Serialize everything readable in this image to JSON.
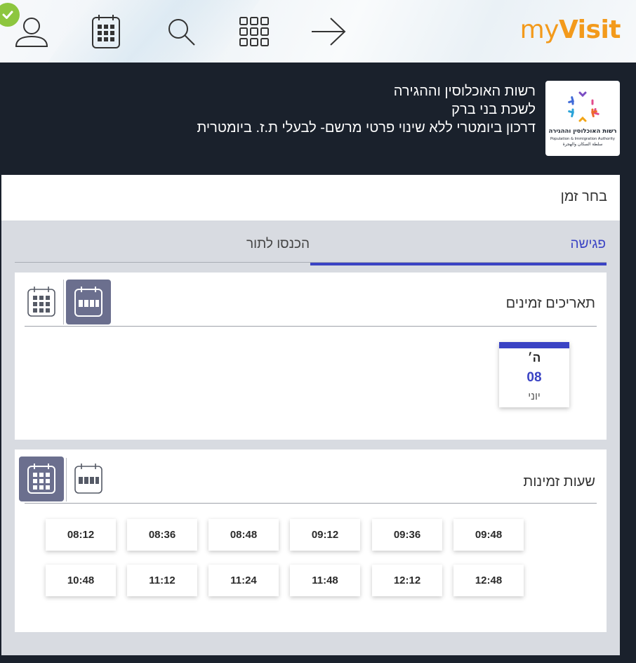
{
  "brand": {
    "logo_light": "my",
    "logo_bold": "Visit",
    "color": "#f39a1b"
  },
  "nav": {
    "icons": [
      "user-icon",
      "calendar-icon",
      "search-icon",
      "grid-menu-icon",
      "arrow-right-icon"
    ],
    "logged_in_badge": "check-icon"
  },
  "office": {
    "logo_title": "רשות האוכלוסין וההגירה",
    "logo_subtitle_en": "Population & Immigration Authority",
    "logo_subtitle_ar": "سلطة السكان والهجرة",
    "line1": "רשות האוכלוסין וההגירה",
    "line2": "לשכת בני ברק",
    "line3": "דרכון ביומטרי ללא שינוי פרטי מרשם- לבעלי ת.ז. ביומטרית"
  },
  "choose_time": "בחר זמן",
  "tabs": {
    "meeting": "פגישה",
    "login": "הכנסו לתור",
    "active": "meeting"
  },
  "dates_card": {
    "title": "תאריכים זמינים",
    "view_toggle": [
      "calendar-week-icon",
      "calendar-month-icon"
    ],
    "active_view": "calendar-week-icon",
    "dates": [
      {
        "day": "ה׳",
        "number": "08",
        "month": "יוני"
      }
    ]
  },
  "hours_card": {
    "title": "שעות זמינות",
    "view_toggle": [
      "calendar-week-icon",
      "calendar-month-icon"
    ],
    "active_view": "calendar-month-icon",
    "slots": [
      "09:48",
      "09:36",
      "09:12",
      "08:48",
      "08:36",
      "08:12",
      "12:48",
      "12:12",
      "11:48",
      "11:24",
      "11:12",
      "10:48"
    ]
  },
  "colors": {
    "accent": "#3a43c4",
    "dark_bg": "#1a212c",
    "toggle_active": "#6b6f8e",
    "panel_gray": "#d8dbe1"
  }
}
